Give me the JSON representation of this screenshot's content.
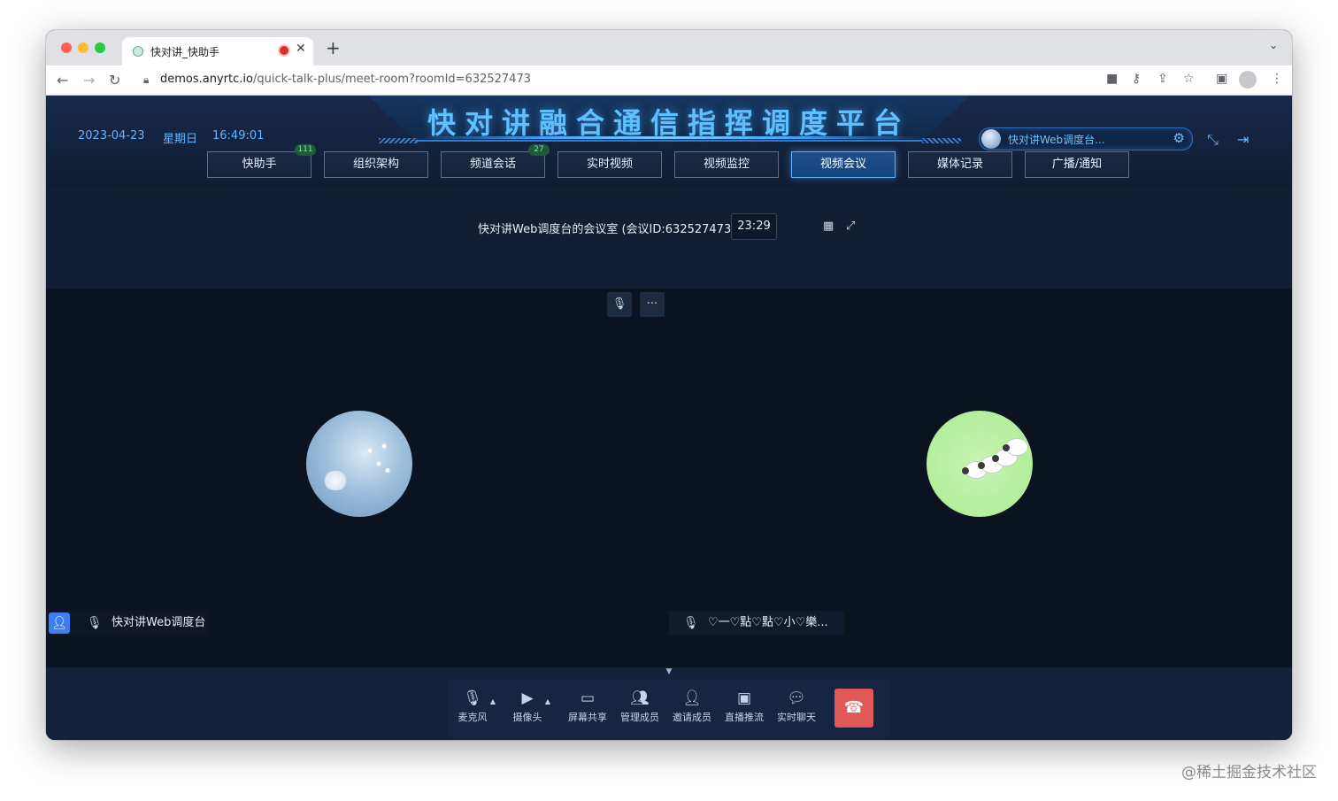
{
  "browser": {
    "tab_title": "快对讲_快助手",
    "url_host": "demos.anyrtc.io",
    "url_path": "/quick-talk-plus/meet-room?roomId=632527473"
  },
  "header": {
    "title": "快对讲融合通信指挥调度平台",
    "date": "2023-04-23",
    "weekday": "星期日",
    "time": "16:49:01",
    "user_name": "快对讲Web调度台..."
  },
  "nav": {
    "items": [
      {
        "label": "快助手",
        "badge": "111"
      },
      {
        "label": "组织架构",
        "badge": ""
      },
      {
        "label": "频道会话",
        "badge": "27"
      },
      {
        "label": "实时视频",
        "badge": ""
      },
      {
        "label": "视频监控",
        "badge": ""
      },
      {
        "label": "视频会议",
        "badge": "",
        "active": true
      },
      {
        "label": "媒体记录",
        "badge": ""
      },
      {
        "label": "广播/通知",
        "badge": ""
      }
    ]
  },
  "meeting": {
    "title": "快对讲Web调度台的会议室 (会议ID:632527473)",
    "duration": "23:29"
  },
  "participants": [
    {
      "name": "快对讲Web调度台"
    },
    {
      "name": "♡一♡點♡點♡小♡樂..."
    }
  ],
  "toolbar": {
    "mic": "麦克风",
    "camera": "摄像头",
    "screen_share": "屏幕共享",
    "manage_members": "管理成员",
    "invite_members": "邀请成员",
    "live_push": "直播推流",
    "chat": "实时聊天"
  },
  "watermark": "@稀土掘金技术社区",
  "colors": {
    "accent": "#5ab1ff",
    "hangup": "#e15858",
    "title": "#5fc0ff"
  }
}
